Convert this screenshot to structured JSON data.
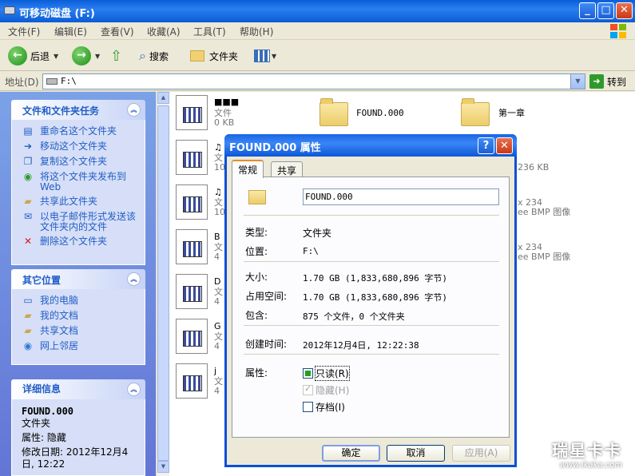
{
  "window": {
    "title": "可移动磁盘 (F:)"
  },
  "menu": [
    "文件(F)",
    "编辑(E)",
    "查看(V)",
    "收藏(A)",
    "工具(T)",
    "帮助(H)"
  ],
  "toolbar": {
    "back": "后退",
    "search": "搜索",
    "folders": "文件夹"
  },
  "address": {
    "label": "地址(D)",
    "value": "F:\\",
    "go": "转到"
  },
  "tasks_panel": {
    "title": "文件和文件夹任务",
    "items": [
      "重命名这个文件夹",
      "移动这个文件夹",
      "复制这个文件夹",
      "将这个文件夹发布到 Web",
      "共享此文件夹",
      "以电子邮件形式发送该文件夹内的文件",
      "删除这个文件夹"
    ]
  },
  "places_panel": {
    "title": "其它位置",
    "items": [
      "我的电脑",
      "我的文档",
      "共享文档",
      "网上邻居"
    ]
  },
  "details_panel": {
    "title": "详细信息",
    "name": "FOUND.000",
    "type": "文件夹",
    "attr": "属性: 隐藏",
    "modified": "修改日期: 2012年12月4日, 12:22"
  },
  "files": {
    "f1_name": "■■■",
    "f1_type": "文件",
    "f1_size": "0 KB",
    "folder1": "FOUND.000",
    "folder2": "第一章",
    "partial_size1": "236 KB",
    "partial_dim": "x 234",
    "partial_bmp": "ee BMP 图像",
    "partial_dim2": "x 234",
    "partial_bmp2": "ee BMP 图像",
    "rows": [
      {
        "a": "♫",
        "b": "文",
        "c": "10"
      },
      {
        "a": "♫",
        "b": "文",
        "c": "10"
      },
      {
        "a": "B",
        "b": "文",
        "c": "4"
      },
      {
        "a": "D",
        "b": "文",
        "c": "4"
      },
      {
        "a": "G",
        "b": "文",
        "c": "4"
      },
      {
        "a": "j",
        "b": "文",
        "c": "4"
      }
    ]
  },
  "dialog": {
    "title": "FOUND.000 属性",
    "tabs": [
      "常规",
      "共享"
    ],
    "name_value": "FOUND.000",
    "type_label": "类型:",
    "type_value": "文件夹",
    "location_label": "位置:",
    "location_value": "F:\\",
    "size_label": "大小:",
    "size_value": "1.70 GB (1,833,680,896 字节)",
    "disk_label": "占用空间:",
    "disk_value": "1.70 GB (1,833,680,896 字节)",
    "contains_label": "包含:",
    "contains_value": "875 个文件，0 个文件夹",
    "created_label": "创建时间:",
    "created_value": "2012年12月4日, 12:22:38",
    "attrs_label": "属性:",
    "readonly": "只读(R)",
    "hidden": "隐藏(H)",
    "archive": "存档(I)",
    "ok": "确定",
    "cancel": "取消",
    "apply": "应用(A)"
  },
  "watermark": {
    "line1": "瑞星卡卡",
    "line2": "www.ikaka.com"
  },
  "colors": {
    "title_blue": "#0b5cd5",
    "task_link": "#215dc6",
    "pane_bg": "#6f8bdf"
  }
}
